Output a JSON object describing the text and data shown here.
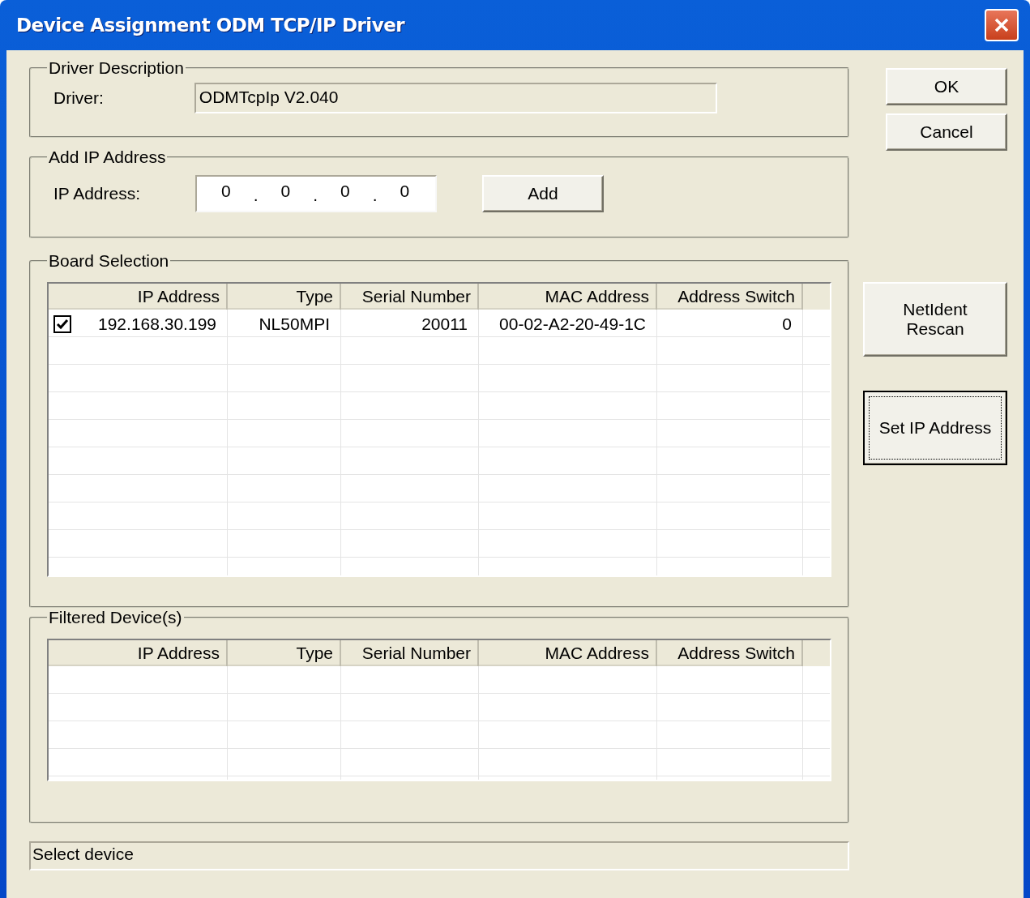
{
  "window": {
    "title": "Device Assignment ODM TCP/IP Driver"
  },
  "driver_description": {
    "legend": "Driver Description",
    "label": "Driver:",
    "value": "ODMTcpIp V2.040"
  },
  "add_ip": {
    "legend": "Add IP Address",
    "label": "IP Address:",
    "octets": [
      "0",
      "0",
      "0",
      "0"
    ],
    "separator": ".",
    "button": "Add"
  },
  "board_selection": {
    "legend": "Board Selection",
    "columns": [
      "IP Address",
      "Type",
      "Serial Number",
      "MAC Address",
      "Address Switch"
    ],
    "rows": [
      {
        "checked": true,
        "cells": [
          "192.168.30.199",
          "NL50MPI",
          "20011",
          "00-02-A2-20-49-1C",
          "0"
        ]
      }
    ]
  },
  "filtered_devices": {
    "legend": "Filtered Device(s)",
    "columns": [
      "IP Address",
      "Type",
      "Serial Number",
      "MAC Address",
      "Address Switch"
    ]
  },
  "status_bar": "Select device",
  "buttons": [
    {
      "label": "OK",
      "focused": false
    },
    {
      "label": "Cancel",
      "focused": false
    },
    {
      "label": "NetIdent Rescan",
      "focused": false
    },
    {
      "label": "Set IP Address",
      "focused": true
    }
  ]
}
